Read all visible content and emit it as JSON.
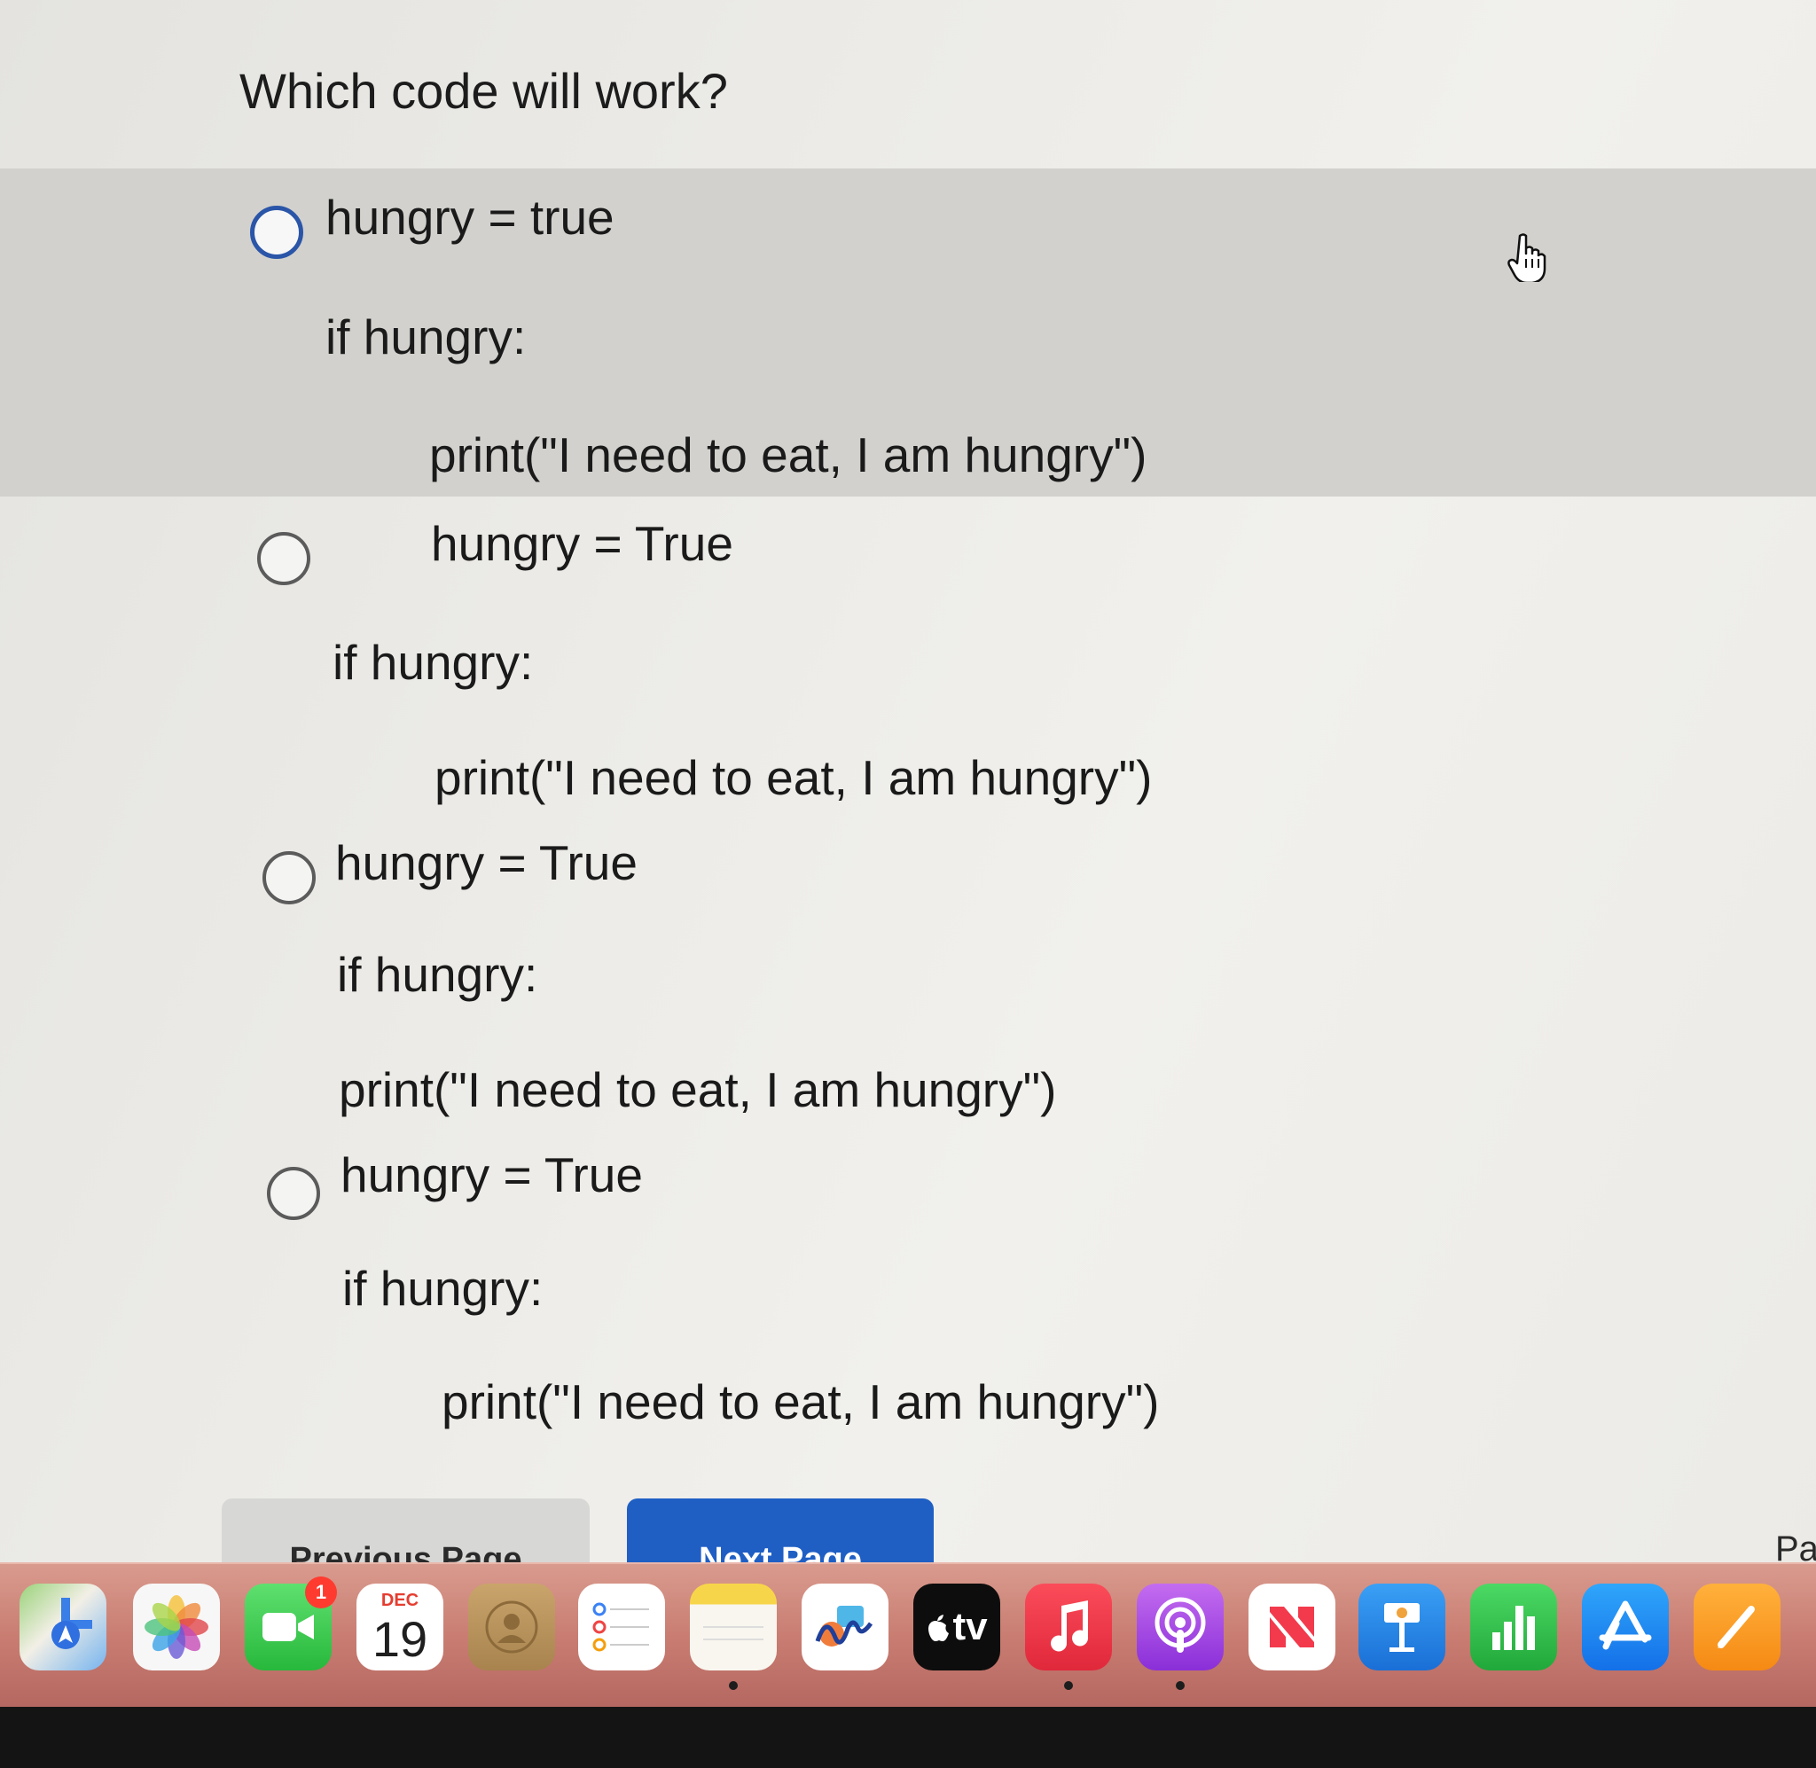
{
  "question": "Which code will work?",
  "options": [
    {
      "line1": "hungry = true",
      "line2": "if hungry:",
      "line3": "print(\"I need to eat, I am hungry\")"
    },
    {
      "line1": "hungry = True",
      "line2": "if hungry:",
      "line3": "print(\"I need to eat, I am hungry\")"
    },
    {
      "line1": "hungry = True",
      "line2": "if hungry:",
      "line3": "print(\"I need to eat, I am hungry\")"
    },
    {
      "line1": "hungry = True",
      "line2": "if hungry:",
      "line3": "print(\"I need to eat, I am hungry\")"
    }
  ],
  "navigation": {
    "previous_label": "Previous Page",
    "next_label": "Next Page",
    "page_label_fragment": "Pa"
  },
  "dock": {
    "facetime_badge": "1",
    "calendar_month": "DEC",
    "calendar_day": "19",
    "tv_label": "tv",
    "apps": [
      "maps-icon",
      "photos-icon",
      "facetime-icon",
      "calendar-icon",
      "contacts-icon",
      "reminders-icon",
      "notes-icon",
      "freeform-icon",
      "apple-tv-icon",
      "music-icon",
      "podcasts-icon",
      "news-icon",
      "keynote-icon",
      "numbers-icon",
      "app-store-icon",
      "pages-icon"
    ]
  },
  "colors": {
    "highlight_row": "#d2d1cd",
    "focused_radio": "#2a55a8",
    "next_button": "#1f5fc4"
  }
}
